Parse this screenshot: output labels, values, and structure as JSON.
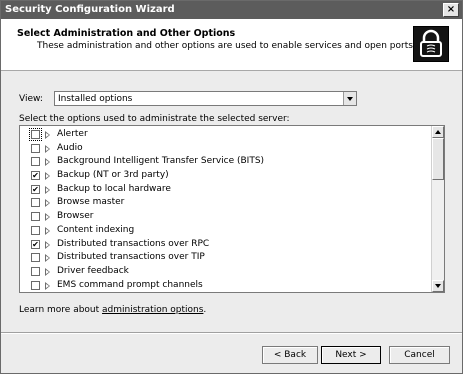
{
  "window": {
    "title": "Security Configuration Wizard",
    "close_label": "×"
  },
  "header": {
    "title": "Select Administration and Other Options",
    "description": "These administration and other options are used to enable services and open ports."
  },
  "view": {
    "label": "View:",
    "selected": "Installed options"
  },
  "instructions": "Select the options used to administrate the selected server:",
  "options": [
    {
      "label": "Alerter",
      "checked": false
    },
    {
      "label": "Audio",
      "checked": false
    },
    {
      "label": "Background Intelligent Transfer Service (BITS)",
      "checked": false
    },
    {
      "label": "Backup (NT or 3rd party)",
      "checked": true
    },
    {
      "label": "Backup to local hardware",
      "checked": true
    },
    {
      "label": "Browse master",
      "checked": false
    },
    {
      "label": "Browser",
      "checked": false
    },
    {
      "label": "Content indexing",
      "checked": false
    },
    {
      "label": "Distributed transactions over RPC",
      "checked": true
    },
    {
      "label": "Distributed transactions over TIP",
      "checked": false
    },
    {
      "label": "Driver feedback",
      "checked": false
    },
    {
      "label": "EMS command prompt channels",
      "checked": false
    }
  ],
  "learn_more": {
    "prefix": "Learn more about ",
    "link": "administration options",
    "suffix": "."
  },
  "buttons": {
    "back": "< Back",
    "next": "Next >",
    "cancel": "Cancel"
  },
  "checkmark": "✔"
}
